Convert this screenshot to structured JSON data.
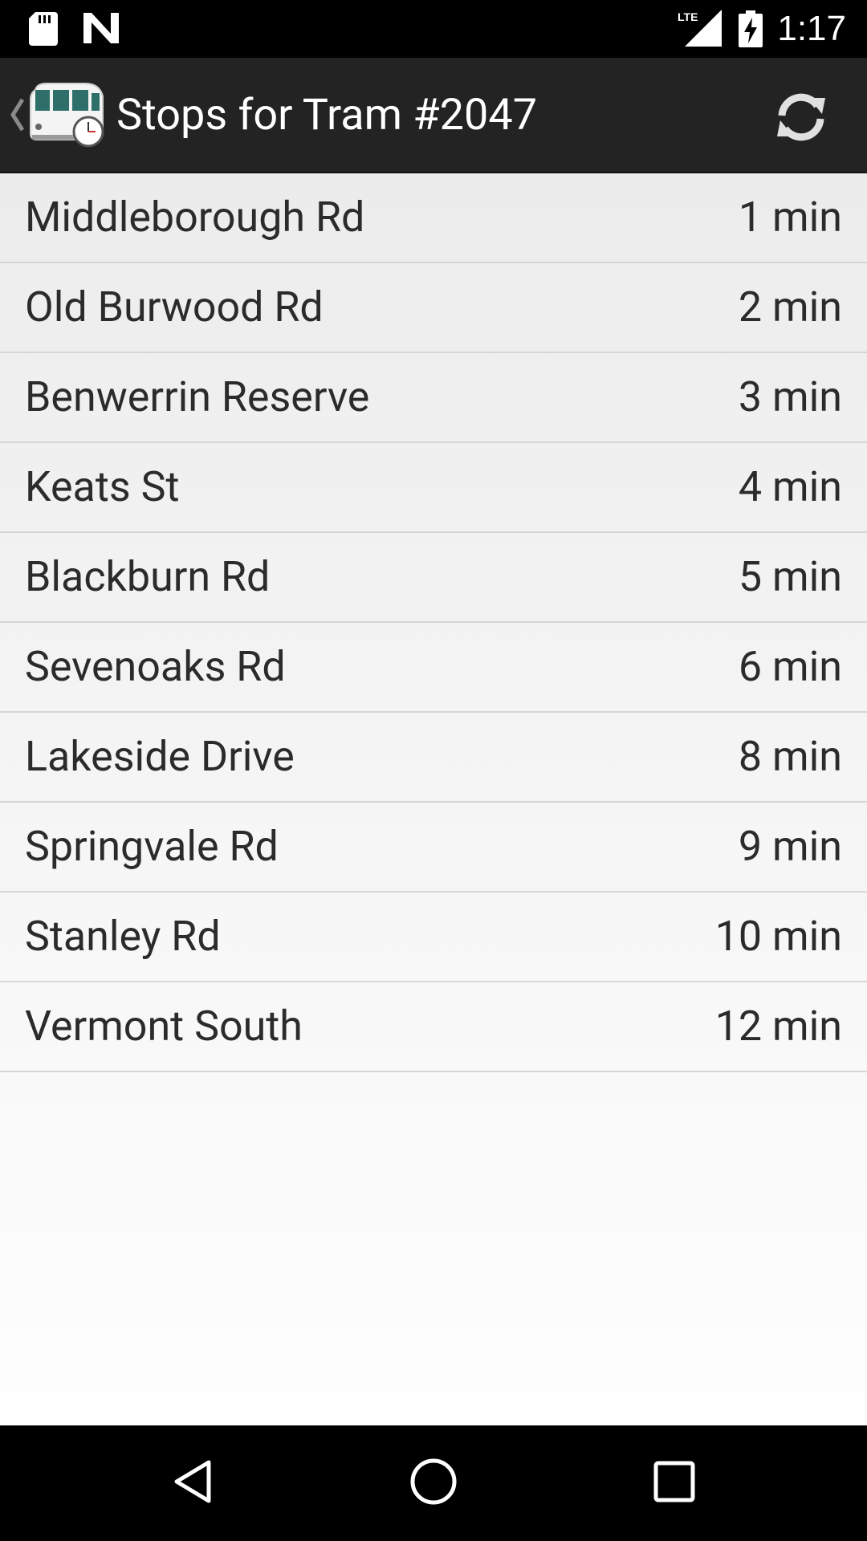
{
  "status_bar": {
    "time": "1:17",
    "network_label": "LTE",
    "icons": [
      "sd-card-icon",
      "n-notification-icon",
      "lte-signal-icon",
      "battery-charging-icon"
    ]
  },
  "action_bar": {
    "title": "Stops for Tram #2047",
    "icons": [
      "back-chevron-icon",
      "tram-clock-app-icon",
      "refresh-icon"
    ]
  },
  "stops": [
    {
      "name": "Middleborough Rd",
      "time": "1 min"
    },
    {
      "name": "Old Burwood Rd",
      "time": "2 min"
    },
    {
      "name": "Benwerrin Reserve",
      "time": "3 min"
    },
    {
      "name": "Keats St",
      "time": "4 min"
    },
    {
      "name": "Blackburn Rd",
      "time": "5 min"
    },
    {
      "name": "Sevenoaks Rd",
      "time": "6 min"
    },
    {
      "name": "Lakeside Drive",
      "time": "8 min"
    },
    {
      "name": "Springvale Rd",
      "time": "9 min"
    },
    {
      "name": "Stanley Rd",
      "time": "10 min"
    },
    {
      "name": "Vermont South",
      "time": "12 min"
    }
  ],
  "nav_bar": {
    "icons": [
      "nav-back-icon",
      "nav-home-icon",
      "nav-recents-icon"
    ]
  },
  "colors": {
    "status_bar": "#000000",
    "action_bar": "#232323",
    "list_background_top": "#ececec",
    "list_background_bottom": "#fefefe",
    "divider": "#d6d6d6",
    "text": "#2b2b2b",
    "nav_bar": "#000000"
  }
}
